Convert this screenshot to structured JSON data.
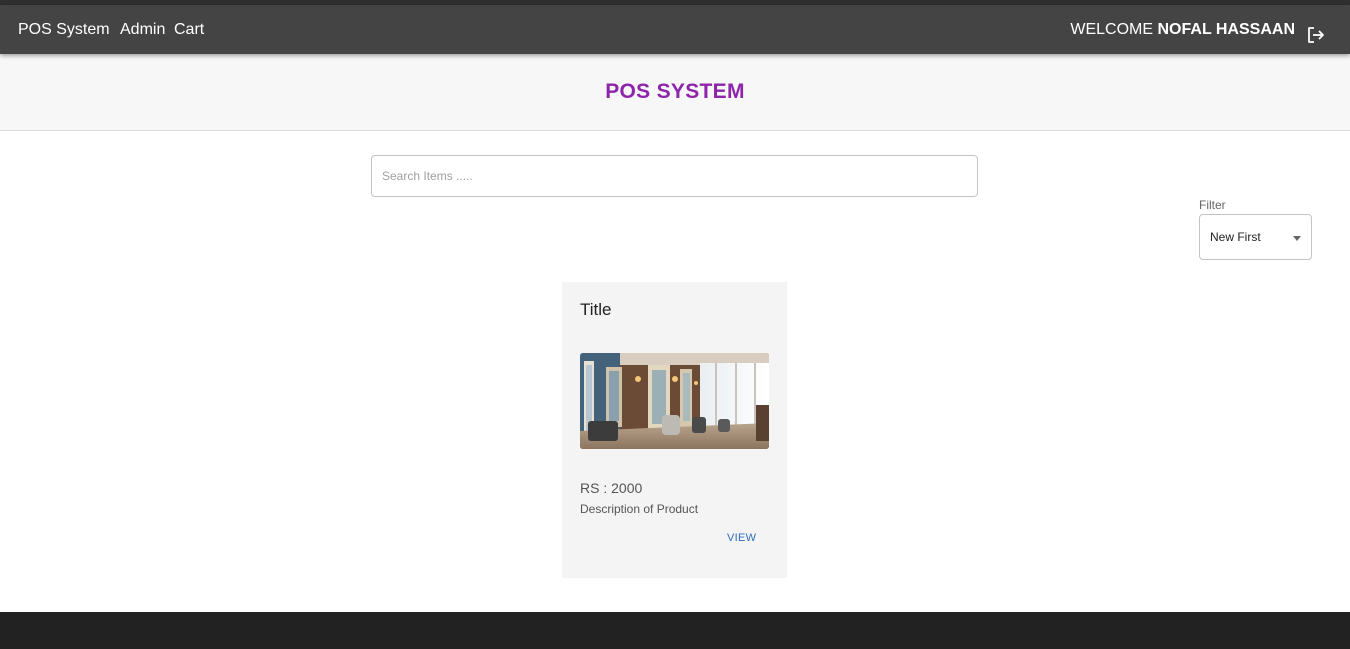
{
  "navbar": {
    "brand": "POS System",
    "links": [
      "Admin",
      "Cart"
    ],
    "welcome_prefix": "WELCOME",
    "user_name": "NOFAL HASSAAN",
    "logout_icon": "logout-icon"
  },
  "banner": {
    "title": "POS SYSTEM",
    "title_color": "#8e24aa"
  },
  "search": {
    "placeholder": "Search Items ....."
  },
  "filter": {
    "label": "Filter",
    "selected": "New First"
  },
  "products": [
    {
      "title": "Title",
      "price": "RS : 2000",
      "description": "Description of Product",
      "action": "VIEW",
      "image": "salon-interior-photo"
    }
  ],
  "colors": {
    "navbar": "#444444",
    "footer": "#222222",
    "link": "#2f6fba"
  }
}
